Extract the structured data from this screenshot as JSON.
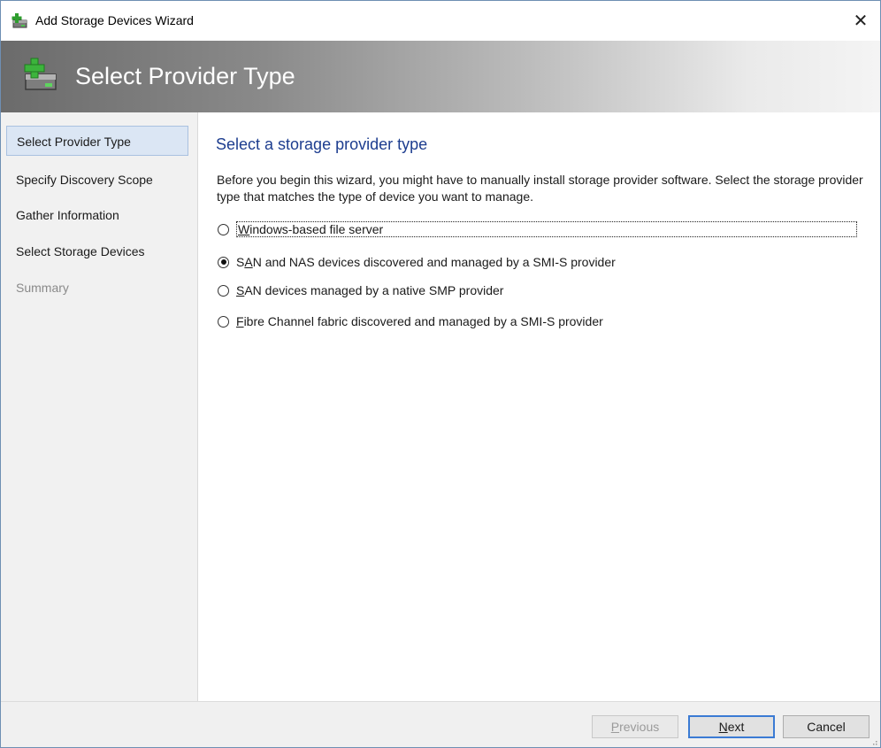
{
  "window": {
    "title": "Add Storage Devices Wizard",
    "close_glyph": "✕"
  },
  "header": {
    "title": "Select Provider Type",
    "icon": "storage-add-icon"
  },
  "nav": {
    "items": [
      {
        "label": "Select Provider Type",
        "state": "active"
      },
      {
        "label": "Specify Discovery Scope",
        "state": "normal"
      },
      {
        "label": "Gather Information",
        "state": "normal"
      },
      {
        "label": "Select Storage Devices",
        "state": "normal"
      },
      {
        "label": "Summary",
        "state": "disabled"
      }
    ]
  },
  "content": {
    "heading": "Select a storage provider type",
    "description": "Before you begin this wizard, you might have to manually install storage provider software. Select the storage provider type that matches the type of device you want to manage.",
    "options": [
      {
        "mnemonic": "W",
        "rest": "indows-based file server",
        "checked": false
      },
      {
        "pre": "S",
        "mnemonic": "A",
        "rest": "N and NAS devices discovered and managed by a SMI-S provider",
        "checked": true
      },
      {
        "mnemonic": "S",
        "rest": "AN devices managed by a native SMP provider",
        "checked": false
      },
      {
        "mnemonic": "F",
        "rest": "ibre Channel fabric discovered and managed by a SMI-S provider",
        "checked": false
      }
    ]
  },
  "footer": {
    "previous": {
      "mnemonic": "P",
      "rest": "revious",
      "enabled": false
    },
    "next": {
      "mnemonic": "N",
      "rest": "ext",
      "enabled": true
    },
    "cancel": "Cancel"
  },
  "colors": {
    "heading": "#1d3d8f",
    "nav_active_bg": "#dbe6f4",
    "accent_border": "#3b7bd4"
  }
}
